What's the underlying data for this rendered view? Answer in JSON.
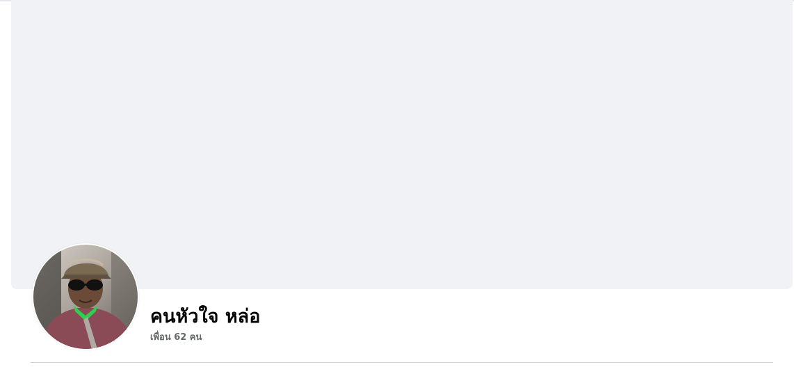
{
  "profile": {
    "name": "คนหัวใจ หล่อ",
    "friends_text": "เพื่อน 62 คน",
    "avatar_description_icon": "profile-photo"
  },
  "colors": {
    "cover_background": "#f0f2f5",
    "name_text": "#050505",
    "secondary_text": "#65676b",
    "divider": "#ced0d4"
  }
}
